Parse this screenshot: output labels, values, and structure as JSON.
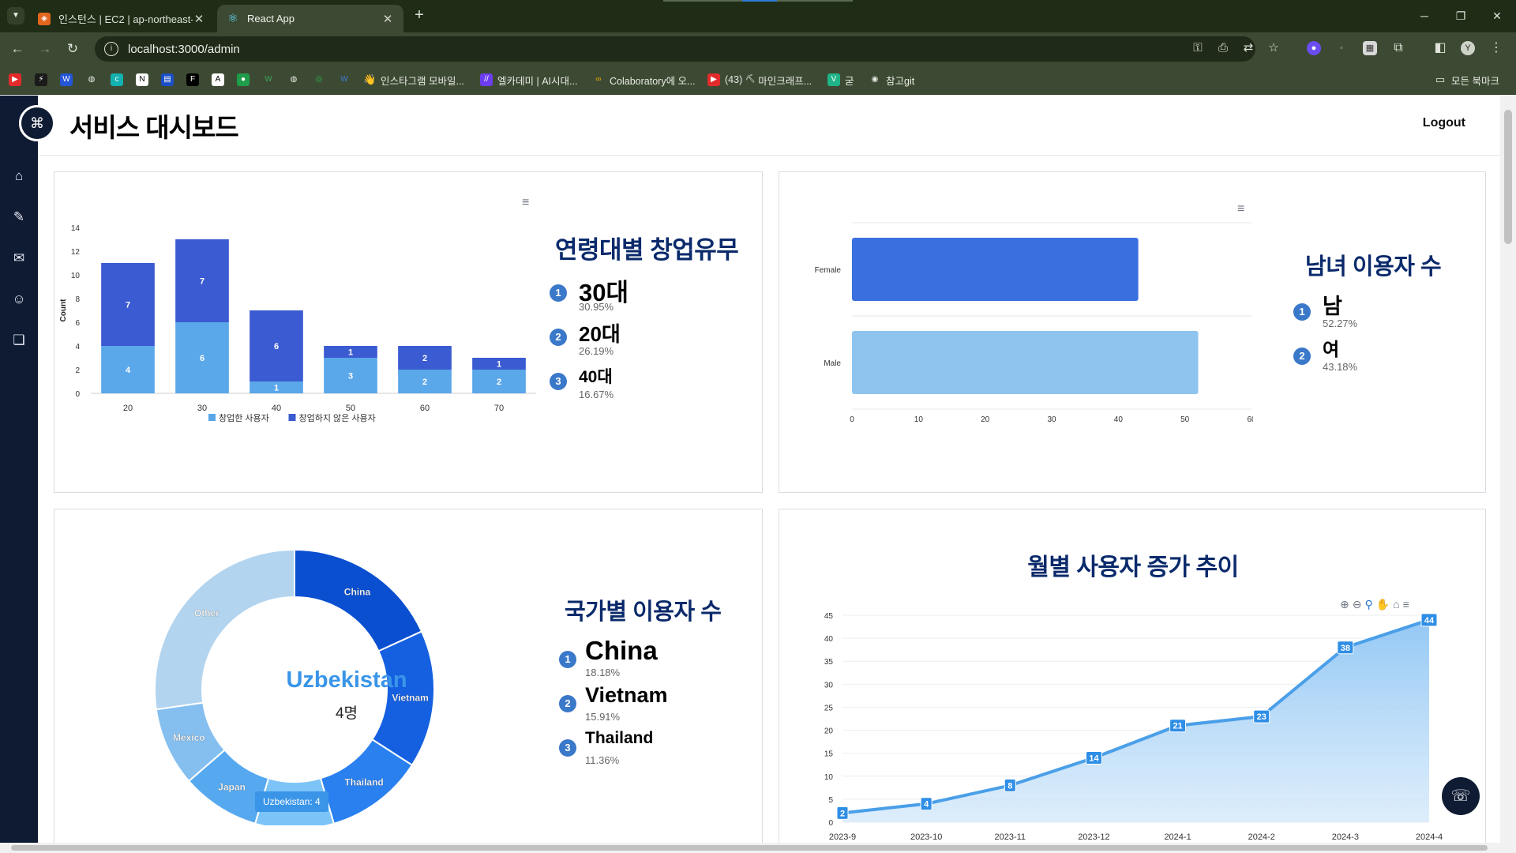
{
  "browser": {
    "tabs": [
      {
        "title": "인스턴스 | EC2 | ap-northeast-",
        "favicon": "aws-icon"
      },
      {
        "title": "React App",
        "favicon": "react-icon"
      }
    ],
    "url": "localhost:3000/admin",
    "bookmarks": [
      {
        "label": "인스타그램 모바일...",
        "icon": "hand-icon"
      },
      {
        "label": "엘카데미 | AI시대...",
        "icon": "elcademy-icon"
      },
      {
        "label": "Colaboratory에 오...",
        "icon": "colab-icon"
      },
      {
        "label": "(43) ",
        "icon": "youtube-icon"
      },
      {
        "label": "마인크래프...",
        "icon": "pickaxe-icon"
      },
      {
        "label": "굳",
        "icon": "vue-icon"
      },
      {
        "label": "참고git",
        "icon": "github-icon"
      }
    ],
    "all_bookmarks": "모든 북마크"
  },
  "app": {
    "title": "서비스 대시보드",
    "logout": "Logout"
  },
  "age_panel": {
    "title": "연령대별 창업유무",
    "ranks": [
      {
        "num": "1",
        "name": "30대",
        "pct": "30.95%"
      },
      {
        "num": "2",
        "name": "20대",
        "pct": "26.19%"
      },
      {
        "num": "3",
        "name": "40대",
        "pct": "16.67%"
      }
    ]
  },
  "gender_panel": {
    "title": "남녀 이용자 수",
    "ranks": [
      {
        "num": "1",
        "name": "남",
        "pct": "52.27%"
      },
      {
        "num": "2",
        "name": "여",
        "pct": "43.18%"
      }
    ]
  },
  "country_panel": {
    "title": "국가별 이용자 수",
    "center_label": "Uzbekistan",
    "center_value": "4명",
    "tooltip": "Uzbekistan:  4",
    "ranks": [
      {
        "num": "1",
        "name": "China",
        "pct": "18.18%"
      },
      {
        "num": "2",
        "name": "Vietnam",
        "pct": "15.91%"
      },
      {
        "num": "3",
        "name": "Thailand",
        "pct": "11.36%"
      }
    ]
  },
  "monthly_panel": {
    "title": "월별 사용자 증가 추이"
  },
  "chart_data": [
    {
      "type": "bar",
      "stacked": true,
      "categories": [
        "20",
        "30",
        "40",
        "50",
        "60",
        "70"
      ],
      "series": [
        {
          "name": "창업한 사용자",
          "values": [
            4,
            6,
            1,
            3,
            2,
            2
          ],
          "color": "#5aa7ea"
        },
        {
          "name": "창업하지 않은 사용자",
          "values": [
            7,
            7,
            6,
            1,
            2,
            1
          ],
          "color": "#3a5bd1"
        }
      ],
      "ylabel": "Count",
      "ylim": [
        0,
        14
      ],
      "yticks": [
        0,
        2,
        4,
        6,
        8,
        10,
        12,
        14
      ],
      "legend": "bottom"
    },
    {
      "type": "bar",
      "orientation": "horizontal",
      "categories": [
        "Female",
        "Male"
      ],
      "values": [
        43,
        52
      ],
      "colors": [
        "#3a6fe0",
        "#8ec4ee"
      ],
      "xlim": [
        0,
        60
      ],
      "xticks": [
        0,
        10,
        20,
        30,
        40,
        50,
        60
      ]
    },
    {
      "type": "pie",
      "donut": true,
      "categories": [
        "China",
        "Vietnam",
        "Thailand",
        "Uzbekistan",
        "Japan",
        "Mexico",
        "Other"
      ],
      "values": [
        8,
        7,
        5,
        4,
        4,
        4,
        12
      ],
      "colors": [
        "#0a4fd0",
        "#1560e0",
        "#2a80ee",
        "#7cc4f7",
        "#56a9ef",
        "#84bff0",
        "#b2d4ef"
      ]
    },
    {
      "type": "area",
      "categories": [
        "2023-9",
        "2023-10",
        "2023-11",
        "2023-12",
        "2024-1",
        "2024-2",
        "2024-3",
        "2024-4"
      ],
      "values": [
        2,
        4,
        8,
        14,
        21,
        23,
        38,
        44
      ],
      "ylim": [
        0,
        45
      ],
      "yticks": [
        0,
        5,
        10,
        15,
        20,
        25,
        30,
        35,
        40,
        45
      ],
      "color": "#4a9fe8"
    }
  ]
}
